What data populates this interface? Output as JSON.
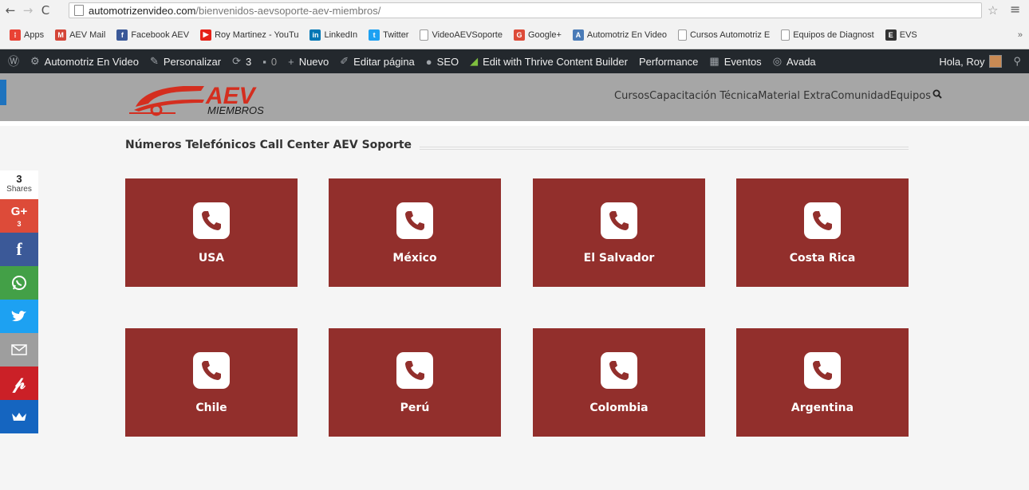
{
  "browser": {
    "url_host": "automotrizenvideo.com",
    "url_path": "/bienvenidos-aevsoporte-aev-miembros/"
  },
  "bookmarks": [
    {
      "label": "Apps",
      "icon": "apps-grid-icon",
      "color": "#e94235"
    },
    {
      "label": "AEV Mail",
      "icon": "gmail-icon",
      "color": "#d44638"
    },
    {
      "label": "Facebook AEV",
      "icon": "facebook-icon",
      "color": "#3b5998"
    },
    {
      "label": "Roy Martinez - YouTu",
      "icon": "youtube-icon",
      "color": "#e62117"
    },
    {
      "label": "LinkedIn",
      "icon": "linkedin-icon",
      "color": "#0077b5"
    },
    {
      "label": "Twitter",
      "icon": "twitter-icon",
      "color": "#1da1f2"
    },
    {
      "label": "VideoAEVSoporte",
      "icon": "page-icon",
      "color": "#999999"
    },
    {
      "label": "Google+",
      "icon": "googleplus-icon",
      "color": "#dd4b39"
    },
    {
      "label": "Automotriz En Video",
      "icon": "site-icon",
      "color": "#4a7bb7"
    },
    {
      "label": "Cursos Automotriz E",
      "icon": "page-icon",
      "color": "#999999"
    },
    {
      "label": "Equipos de Diagnost",
      "icon": "page-icon",
      "color": "#999999"
    },
    {
      "label": "EVS",
      "icon": "evs-icon",
      "color": "#333333"
    }
  ],
  "adminbar": {
    "site": "Automotriz En Video",
    "customize": "Personalizar",
    "updates": "3",
    "comments": "0",
    "new": "Nuevo",
    "edit": "Editar página",
    "seo": "SEO",
    "thrive": "Edit with Thrive Content Builder",
    "performance": "Performance",
    "events": "Eventos",
    "avada": "Avada",
    "greeting": "Hola, Roy"
  },
  "header": {
    "logo_text": "AEV",
    "logo_sub": "MIEMBROS",
    "nav": [
      "Cursos",
      "Capacitación Técnica",
      "Material Extra",
      "Comunidad",
      "Equipos"
    ]
  },
  "main": {
    "title": "Números Telefónicos Call Center AEV Soporte",
    "countries": [
      "USA",
      "México",
      "El Salvador",
      "Costa Rica",
      "Chile",
      "Perú",
      "Colombia",
      "Argentina"
    ]
  },
  "share": {
    "count": "3",
    "label": "Shares",
    "gplus_count": "3"
  },
  "colors": {
    "tile": "#922f2c",
    "header": "#a6a6a6",
    "adminbar": "#23282d",
    "logo_red": "#d42e1f"
  }
}
